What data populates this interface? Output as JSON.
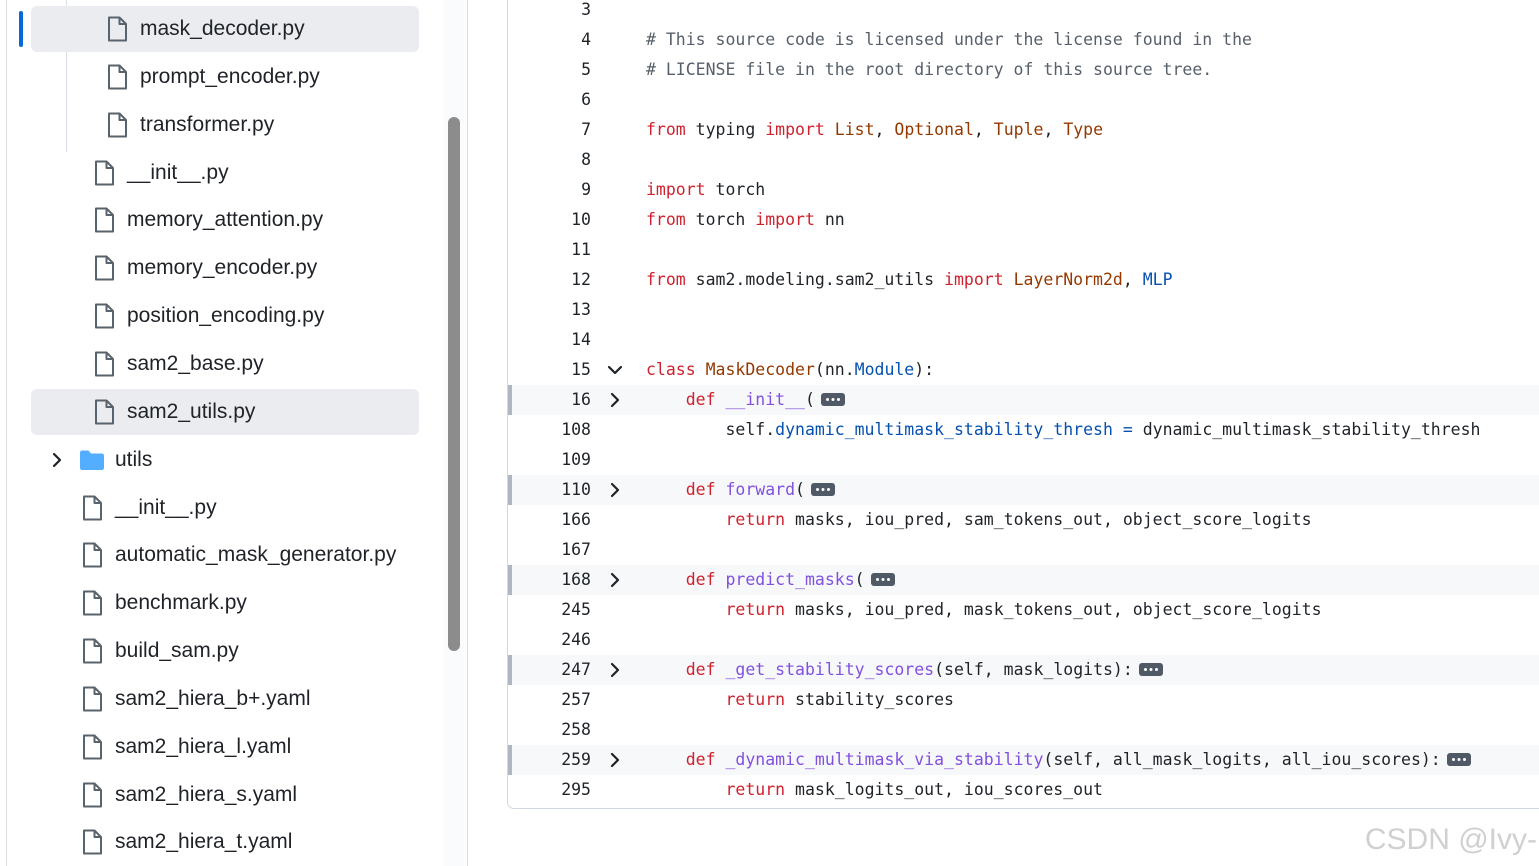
{
  "sidebar": {
    "items": [
      {
        "name": "mask_decoder.py",
        "kind": "file",
        "selected": true
      },
      {
        "name": "prompt_encoder.py",
        "kind": "file"
      },
      {
        "name": "transformer.py",
        "kind": "file"
      },
      {
        "name": "__init__.py",
        "kind": "file"
      },
      {
        "name": "memory_attention.py",
        "kind": "file"
      },
      {
        "name": "memory_encoder.py",
        "kind": "file"
      },
      {
        "name": "position_encoding.py",
        "kind": "file"
      },
      {
        "name": "sam2_base.py",
        "kind": "file"
      },
      {
        "name": "sam2_utils.py",
        "kind": "file",
        "selected": true
      },
      {
        "name": "utils",
        "kind": "folder",
        "collapsed": true
      },
      {
        "name": "__init__.py",
        "kind": "file"
      },
      {
        "name": "automatic_mask_generator.py",
        "kind": "file"
      },
      {
        "name": "benchmark.py",
        "kind": "file"
      },
      {
        "name": "build_sam.py",
        "kind": "file"
      },
      {
        "name": "sam2_hiera_b+.yaml",
        "kind": "file"
      },
      {
        "name": "sam2_hiera_l.yaml",
        "kind": "file"
      },
      {
        "name": "sam2_hiera_s.yaml",
        "kind": "file"
      },
      {
        "name": "sam2_hiera_t.yaml",
        "kind": "file"
      }
    ]
  },
  "code": {
    "lines": [
      {
        "n": "3",
        "tokens": []
      },
      {
        "n": "4",
        "tokens": [
          [
            "c",
            "# This source code is licensed under the license found in the"
          ]
        ]
      },
      {
        "n": "5",
        "tokens": [
          [
            "c",
            "# LICENSE file in the root directory of this source tree."
          ]
        ]
      },
      {
        "n": "6",
        "tokens": []
      },
      {
        "n": "7",
        "tokens": [
          [
            "k",
            "from"
          ],
          [
            "p",
            " typing "
          ],
          [
            "k",
            "import"
          ],
          [
            "p",
            " "
          ],
          [
            "t",
            "List"
          ],
          [
            "p",
            ", "
          ],
          [
            "t",
            "Optional"
          ],
          [
            "p",
            ", "
          ],
          [
            "t",
            "Tuple"
          ],
          [
            "p",
            ", "
          ],
          [
            "t",
            "Type"
          ]
        ]
      },
      {
        "n": "8",
        "tokens": []
      },
      {
        "n": "9",
        "tokens": [
          [
            "k",
            "import"
          ],
          [
            "p",
            " torch"
          ]
        ]
      },
      {
        "n": "10",
        "tokens": [
          [
            "k",
            "from"
          ],
          [
            "p",
            " torch "
          ],
          [
            "k",
            "import"
          ],
          [
            "p",
            " nn"
          ]
        ]
      },
      {
        "n": "11",
        "tokens": []
      },
      {
        "n": "12",
        "tokens": [
          [
            "k",
            "from"
          ],
          [
            "p",
            " sam2.modeling.sam2_utils "
          ],
          [
            "k",
            "import"
          ],
          [
            "p",
            " "
          ],
          [
            "t",
            "LayerNorm2d"
          ],
          [
            "p",
            ", "
          ],
          [
            "b",
            "MLP"
          ]
        ]
      },
      {
        "n": "13",
        "tokens": []
      },
      {
        "n": "14",
        "tokens": []
      },
      {
        "n": "15",
        "fold": "open",
        "tokens": [
          [
            "k",
            "class"
          ],
          [
            "p",
            " "
          ],
          [
            "t",
            "MaskDecoder"
          ],
          [
            "p",
            "(nn."
          ],
          [
            "b",
            "Module"
          ],
          [
            "p",
            "):"
          ]
        ]
      },
      {
        "n": "16",
        "fold": "closed",
        "ellipsis": true,
        "tokens": [
          [
            "p",
            "    "
          ],
          [
            "k",
            "def"
          ],
          [
            "p",
            " "
          ],
          [
            "f",
            "__init__"
          ],
          [
            "p",
            "("
          ]
        ]
      },
      {
        "n": "108",
        "tokens": [
          [
            "p",
            "        self."
          ],
          [
            "b",
            "dynamic_multimask_stability_thresh"
          ],
          [
            "p",
            " "
          ],
          [
            "b",
            "="
          ],
          [
            "p",
            " dynamic_multimask_stability_thresh"
          ]
        ]
      },
      {
        "n": "109",
        "tokens": []
      },
      {
        "n": "110",
        "fold": "closed",
        "ellipsis": true,
        "tokens": [
          [
            "p",
            "    "
          ],
          [
            "k",
            "def"
          ],
          [
            "p",
            " "
          ],
          [
            "f",
            "forward"
          ],
          [
            "p",
            "("
          ]
        ]
      },
      {
        "n": "166",
        "tokens": [
          [
            "p",
            "        "
          ],
          [
            "k",
            "return"
          ],
          [
            "p",
            " masks, iou_pred, sam_tokens_out, object_score_logits"
          ]
        ]
      },
      {
        "n": "167",
        "tokens": []
      },
      {
        "n": "168",
        "fold": "closed",
        "ellipsis": true,
        "tokens": [
          [
            "p",
            "    "
          ],
          [
            "k",
            "def"
          ],
          [
            "p",
            " "
          ],
          [
            "f",
            "predict_masks"
          ],
          [
            "p",
            "("
          ]
        ]
      },
      {
        "n": "245",
        "tokens": [
          [
            "p",
            "        "
          ],
          [
            "k",
            "return"
          ],
          [
            "p",
            " masks, iou_pred, mask_tokens_out, object_score_logits"
          ]
        ]
      },
      {
        "n": "246",
        "tokens": []
      },
      {
        "n": "247",
        "fold": "closed",
        "ellipsis": true,
        "tokens": [
          [
            "p",
            "    "
          ],
          [
            "k",
            "def"
          ],
          [
            "p",
            " "
          ],
          [
            "f",
            "_get_stability_scores"
          ],
          [
            "p",
            "(self, mask_logits):"
          ]
        ]
      },
      {
        "n": "257",
        "tokens": [
          [
            "p",
            "        "
          ],
          [
            "k",
            "return"
          ],
          [
            "p",
            " stability_scores"
          ]
        ]
      },
      {
        "n": "258",
        "tokens": []
      },
      {
        "n": "259",
        "fold": "closed",
        "ellipsis": true,
        "tokens": [
          [
            "p",
            "    "
          ],
          [
            "k",
            "def"
          ],
          [
            "p",
            " "
          ],
          [
            "f",
            "_dynamic_multimask_via_stability"
          ],
          [
            "p",
            "(self, all_mask_logits, all_iou_scores):"
          ]
        ]
      },
      {
        "n": "295",
        "tokens": [
          [
            "p",
            "        "
          ],
          [
            "k",
            "return"
          ],
          [
            "p",
            " mask_logits_out, iou_scores_out"
          ]
        ]
      }
    ]
  },
  "watermark": "CSDN @Ivy-"
}
